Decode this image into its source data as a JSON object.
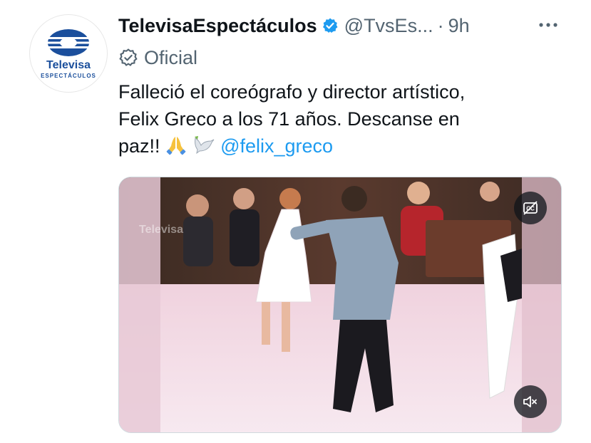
{
  "account": {
    "display_name": "TelevisaEspectáculos",
    "handle": "@TvsEs...",
    "separator": "·",
    "time": "9h",
    "badge": "Oficial",
    "avatar_wordmark": "Televisa",
    "avatar_subword": "ESPECTÁCULOS"
  },
  "tweet": {
    "line1": "Falleció el coreógrafo y director artístico,",
    "line2": "Felix Greco a los 71 años. Descanse en",
    "line3_prefix": "paz!!",
    "emoji_1": "🙏",
    "emoji_2": "🕊",
    "mention": "@felix_greco"
  },
  "media": {
    "watermark_text": "Televisa",
    "cc_icon": "closed-captions-off-icon",
    "mute_icon": "speaker-muted-icon"
  },
  "icons": {
    "verified": "verified-badge-icon",
    "official": "official-check-icon",
    "more": "more-dots-icon"
  },
  "colors": {
    "text": "#0f1419",
    "secondary": "#536471",
    "accent": "#1d9bf0",
    "brand": "#1b4f9c"
  }
}
